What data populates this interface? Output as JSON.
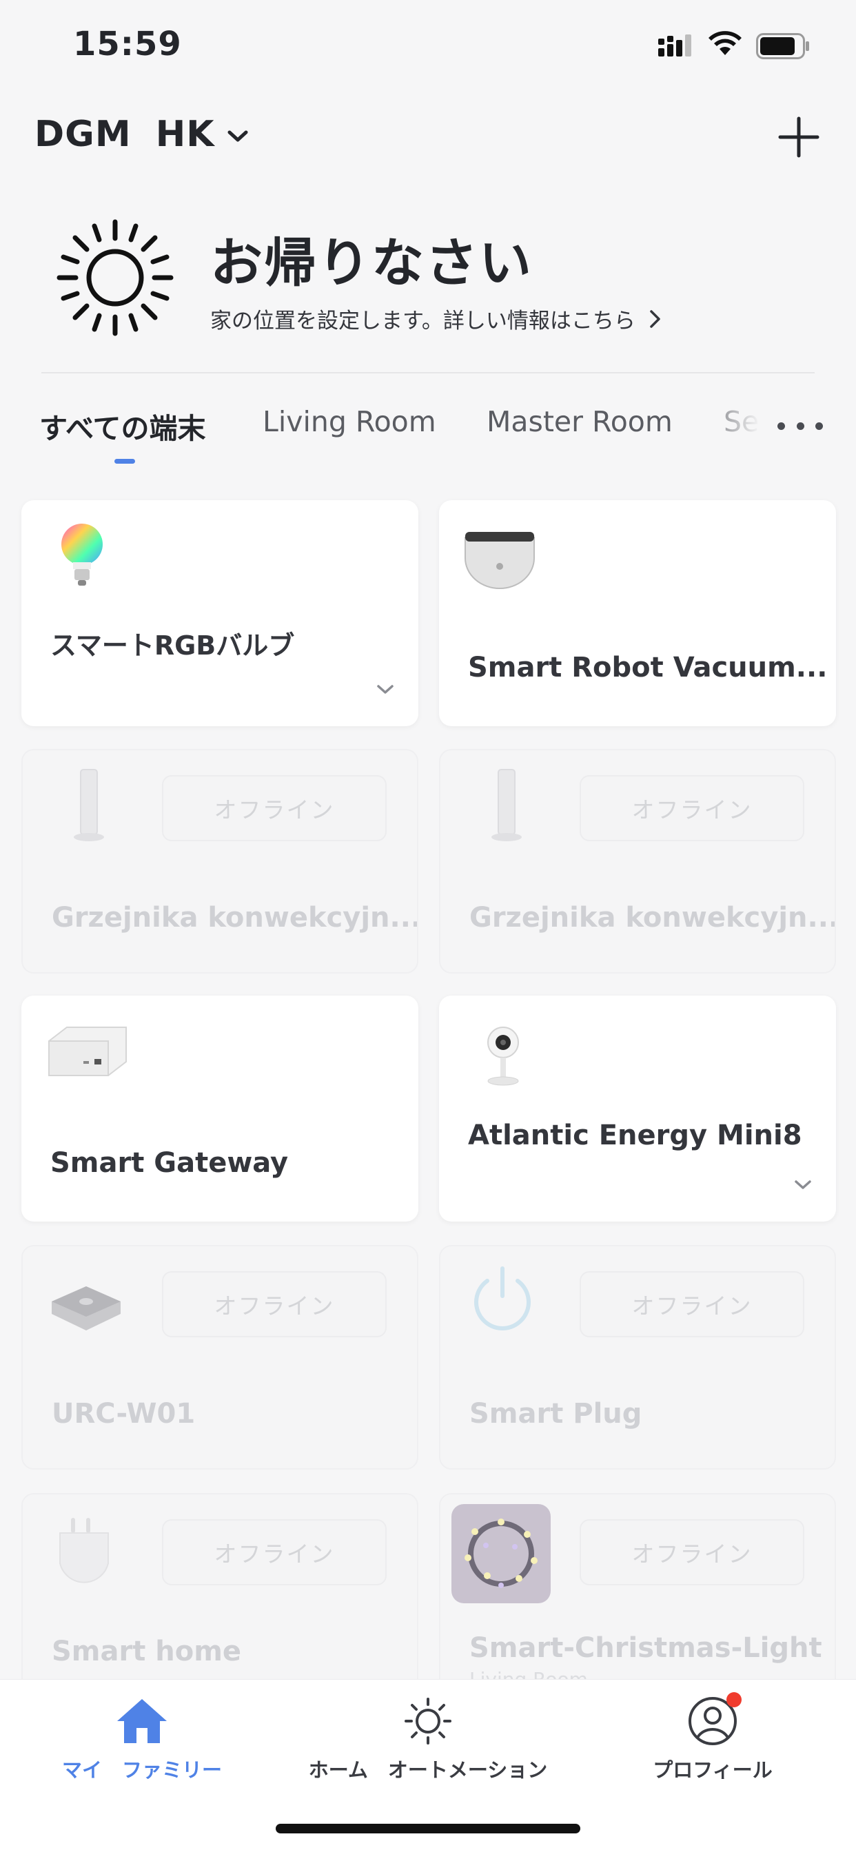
{
  "status_bar": {
    "time": "15:59",
    "icons": [
      "cellular-icon",
      "wifi-icon",
      "battery-icon"
    ]
  },
  "header": {
    "home_name": "DGM  HK",
    "icons": [
      "chevron-down-icon",
      "plus-icon"
    ]
  },
  "welcome": {
    "weather_icon": "sun-icon",
    "title": "お帰りなさい",
    "subtitle": "家の位置を設定します。詳しい情報はこちら"
  },
  "tabs": [
    {
      "label": "すべての端末",
      "active": true
    },
    {
      "label": "Living Room",
      "active": false
    },
    {
      "label": "Master Room",
      "active": false
    },
    {
      "label": "Se",
      "active": false
    }
  ],
  "devices": [
    {
      "name": "スマートRGBバルブ",
      "status": "online",
      "icon": "rgb-bulb-icon",
      "expandable": true
    },
    {
      "name": "Smart Robot Vacuum...",
      "status": "online",
      "icon": "robot-vacuum-icon",
      "expandable": false
    },
    {
      "name": "Grzejnika konwekcyjn...",
      "status": "offline",
      "status_label": "オフライン",
      "icon": "convector-heater-icon"
    },
    {
      "name": "Grzejnika konwekcyjn...",
      "status": "offline",
      "status_label": "オフライン",
      "icon": "convector-heater-icon"
    },
    {
      "name": "Smart Gateway",
      "status": "online",
      "icon": "gateway-icon",
      "expandable": false
    },
    {
      "name": "Atlantic Energy Mini8",
      "status": "online",
      "icon": "camera-icon",
      "expandable": true
    },
    {
      "name": "URC-W01",
      "status": "offline",
      "status_label": "オフライン",
      "icon": "ir-remote-hub-icon"
    },
    {
      "name": "Smart Plug",
      "status": "offline",
      "status_label": "オフライン",
      "icon": "power-icon"
    },
    {
      "name": "Smart  home",
      "status": "offline",
      "status_label": "オフライン",
      "icon": "plug-icon"
    },
    {
      "name": "Smart-Christmas-Light",
      "room": "Living Room",
      "status": "offline",
      "status_label": "オフライン",
      "icon": "christmas-lights-icon"
    }
  ],
  "bottom_nav": [
    {
      "label": "マイ　ファミリー",
      "icon": "house-icon",
      "active": true
    },
    {
      "label": "ホーム　オートメーション",
      "icon": "sun-icon",
      "active": false
    },
    {
      "label": "プロフィール",
      "icon": "profile-icon",
      "active": false,
      "badge": true
    }
  ],
  "colors": {
    "accent": "#4f82e6",
    "badge": "#f03c2e",
    "background": "#f6f6f7"
  }
}
